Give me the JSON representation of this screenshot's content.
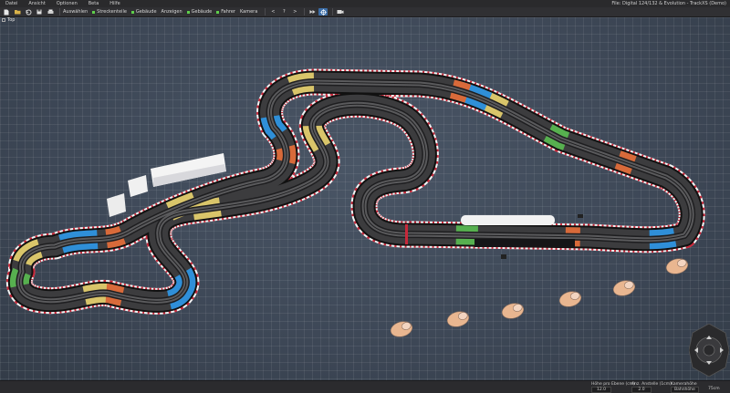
{
  "window_title": "File: Digital 124/132 & Evolution - TrackXS (Demo)",
  "menu": [
    "Datei",
    "Ansicht",
    "Optionen",
    "Beta",
    "Hilfe"
  ],
  "toolbar": {
    "nav_buttons": [
      "<",
      "?",
      ">"
    ],
    "tools": [
      {
        "label": "Auswählen",
        "has_dot": false
      },
      {
        "label": "Streckenteile",
        "has_dot": true
      },
      {
        "label": "Gebäude",
        "has_dot": true
      },
      {
        "label": "Anzeigen",
        "has_dot": false
      },
      {
        "label": "Gebäude",
        "has_dot": true
      },
      {
        "label": "Fahrer",
        "has_dot": true
      },
      {
        "label": "Kamera",
        "has_dot": false
      }
    ],
    "icons": [
      "new-icon",
      "open-icon",
      "undo-icon",
      "save-icon",
      "print-icon",
      "zoom-in-icon",
      "select-crosshair-icon",
      "camera-icon"
    ]
  },
  "viewport": {
    "view_label": "Top",
    "accent_colors": {
      "orange": "#d86a3a",
      "yellow": "#d9c56a",
      "blue": "#2f8fd8",
      "green": "#57b04f",
      "curb_red": "#c8283a"
    }
  },
  "statusbar": {
    "height_per_level": {
      "label": "Höhe pro Ebene (cm)",
      "value": "12.0"
    },
    "num_supports": {
      "label": "Anz. Anstelle (1cm)",
      "value": "2.0"
    },
    "camera_height": {
      "label": "Kamerahöhe",
      "value": "Bahnhöhe"
    },
    "zoom": {
      "value": "75cm"
    }
  }
}
